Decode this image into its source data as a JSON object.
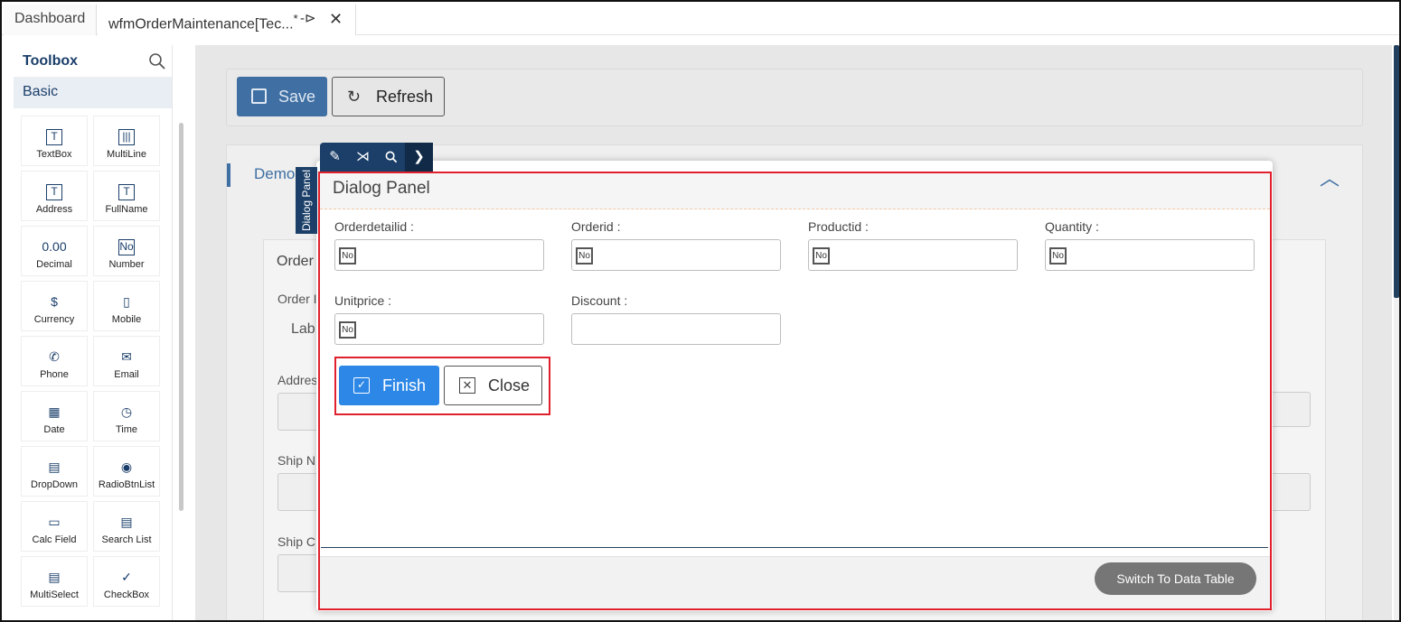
{
  "tabs": [
    {
      "label": "Dashboard"
    },
    {
      "label": "wfmOrderMaintenance[Tec...",
      "modified": "*",
      "pin": "-⊳",
      "close": "✕"
    }
  ],
  "toolbox": {
    "title": "Toolbox",
    "category": "Basic",
    "items": [
      {
        "label": "TextBox",
        "icon": "text-box-icon",
        "glyph": "T"
      },
      {
        "label": "MultiLine",
        "icon": "multiline-icon",
        "glyph": "|||"
      },
      {
        "label": "Address",
        "icon": "address-icon",
        "glyph": "T"
      },
      {
        "label": "FullName",
        "icon": "fullname-icon",
        "glyph": "T"
      },
      {
        "label": "Decimal",
        "icon": "decimal-icon",
        "glyph": "0.00"
      },
      {
        "label": "Number",
        "icon": "number-icon",
        "glyph": "No"
      },
      {
        "label": "Currency",
        "icon": "currency-icon",
        "glyph": "$"
      },
      {
        "label": "Mobile",
        "icon": "mobile-icon",
        "glyph": "▯"
      },
      {
        "label": "Phone",
        "icon": "phone-icon",
        "glyph": "✆"
      },
      {
        "label": "Email",
        "icon": "email-icon",
        "glyph": "✉"
      },
      {
        "label": "Date",
        "icon": "calendar-icon",
        "glyph": "▦"
      },
      {
        "label": "Time",
        "icon": "clock-icon",
        "glyph": "◷"
      },
      {
        "label": "DropDown",
        "icon": "dropdown-icon",
        "glyph": "▤"
      },
      {
        "label": "RadioBtnList",
        "icon": "radio-list-icon",
        "glyph": "◉"
      },
      {
        "label": "Calc Field",
        "icon": "calc-field-icon",
        "glyph": "▭"
      },
      {
        "label": "Search List",
        "icon": "search-list-icon",
        "glyph": "▤"
      },
      {
        "label": "MultiSelect",
        "icon": "multiselect-icon",
        "glyph": "▤"
      },
      {
        "label": "CheckBox",
        "icon": "checkbox-icon",
        "glyph": "✓"
      }
    ]
  },
  "form": {
    "save_label": "Save",
    "refresh_label": "Refresh",
    "section_title": "Demo",
    "inner_tab": "Order",
    "bg_labels": {
      "order": "Order I",
      "lab": "Lab",
      "address": "Addres",
      "ship_name": "Ship N",
      "ship_c": "Ship C"
    }
  },
  "dialog": {
    "tag": "Dialog Panel",
    "title": "Dialog Panel",
    "fields": [
      {
        "label": "Orderdetailid :",
        "value": "No"
      },
      {
        "label": "Orderid :",
        "value": "No"
      },
      {
        "label": "Productid :",
        "value": "No"
      },
      {
        "label": "Quantity :",
        "value": "No"
      },
      {
        "label": "Unitprice :",
        "value": "No"
      },
      {
        "label": "Discount :",
        "value": ""
      }
    ],
    "finish_label": "Finish",
    "close_label": "Close",
    "switch_label": "Switch To Data Table"
  },
  "colors": {
    "accent": "#2d87e6",
    "highlight": "#e0212d",
    "dark": "#1b3f68"
  }
}
